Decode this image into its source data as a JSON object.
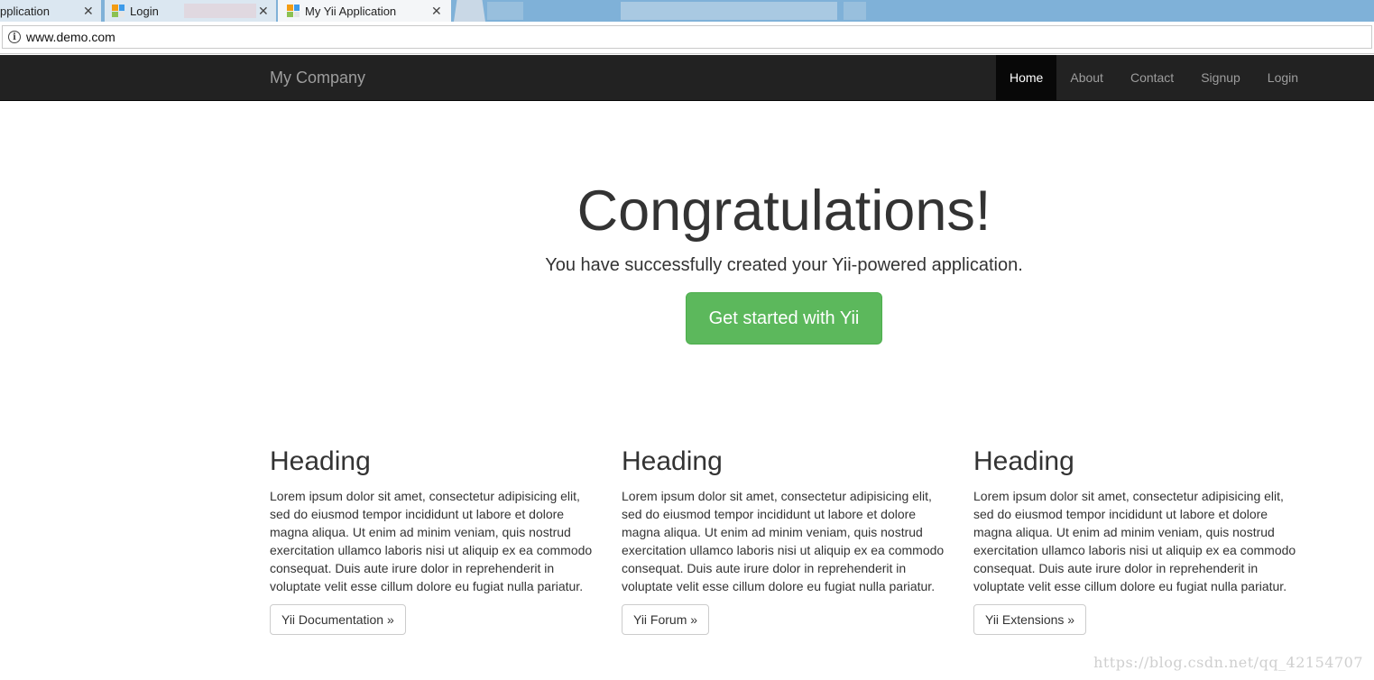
{
  "browser": {
    "tabs": [
      {
        "label": "pplication",
        "close": "✕"
      },
      {
        "label": "Login",
        "close": "✕"
      },
      {
        "label": "My Yii Application",
        "close": "✕"
      }
    ],
    "address": "www.demo.com"
  },
  "navbar": {
    "brand": "My Company",
    "items": [
      {
        "label": "Home",
        "active": true
      },
      {
        "label": "About"
      },
      {
        "label": "Contact"
      },
      {
        "label": "Signup"
      },
      {
        "label": "Login"
      }
    ]
  },
  "jumbotron": {
    "title": "Congratulations!",
    "lead": "You have successfully created your Yii-powered application.",
    "button": "Get started with Yii"
  },
  "columns": [
    {
      "heading": "Heading",
      "text": "Lorem ipsum dolor sit amet, consectetur adipisicing elit, sed do eiusmod tempor incididunt ut labore et dolore magna aliqua. Ut enim ad minim veniam, quis nostrud exercitation ullamco laboris nisi ut aliquip ex ea commodo consequat. Duis aute irure dolor in reprehenderit in voluptate velit esse cillum dolore eu fugiat nulla pariatur.",
      "button": "Yii Documentation »"
    },
    {
      "heading": "Heading",
      "text": "Lorem ipsum dolor sit amet, consectetur adipisicing elit, sed do eiusmod tempor incididunt ut labore et dolore magna aliqua. Ut enim ad minim veniam, quis nostrud exercitation ullamco laboris nisi ut aliquip ex ea commodo consequat. Duis aute irure dolor in reprehenderit in voluptate velit esse cillum dolore eu fugiat nulla pariatur.",
      "button": "Yii Forum »"
    },
    {
      "heading": "Heading",
      "text": "Lorem ipsum dolor sit amet, consectetur adipisicing elit, sed do eiusmod tempor incididunt ut labore et dolore magna aliqua. Ut enim ad minim veniam, quis nostrud exercitation ullamco laboris nisi ut aliquip ex ea commodo consequat. Duis aute irure dolor in reprehenderit in voluptate velit esse cillum dolore eu fugiat nulla pariatur.",
      "button": "Yii Extensions »"
    }
  ],
  "watermark": "https://blog.csdn.net/qq_42154707",
  "colors": {
    "navbar_bg": "#222222",
    "success": "#5cb85c",
    "tabstrip": "#7fb1d8"
  }
}
